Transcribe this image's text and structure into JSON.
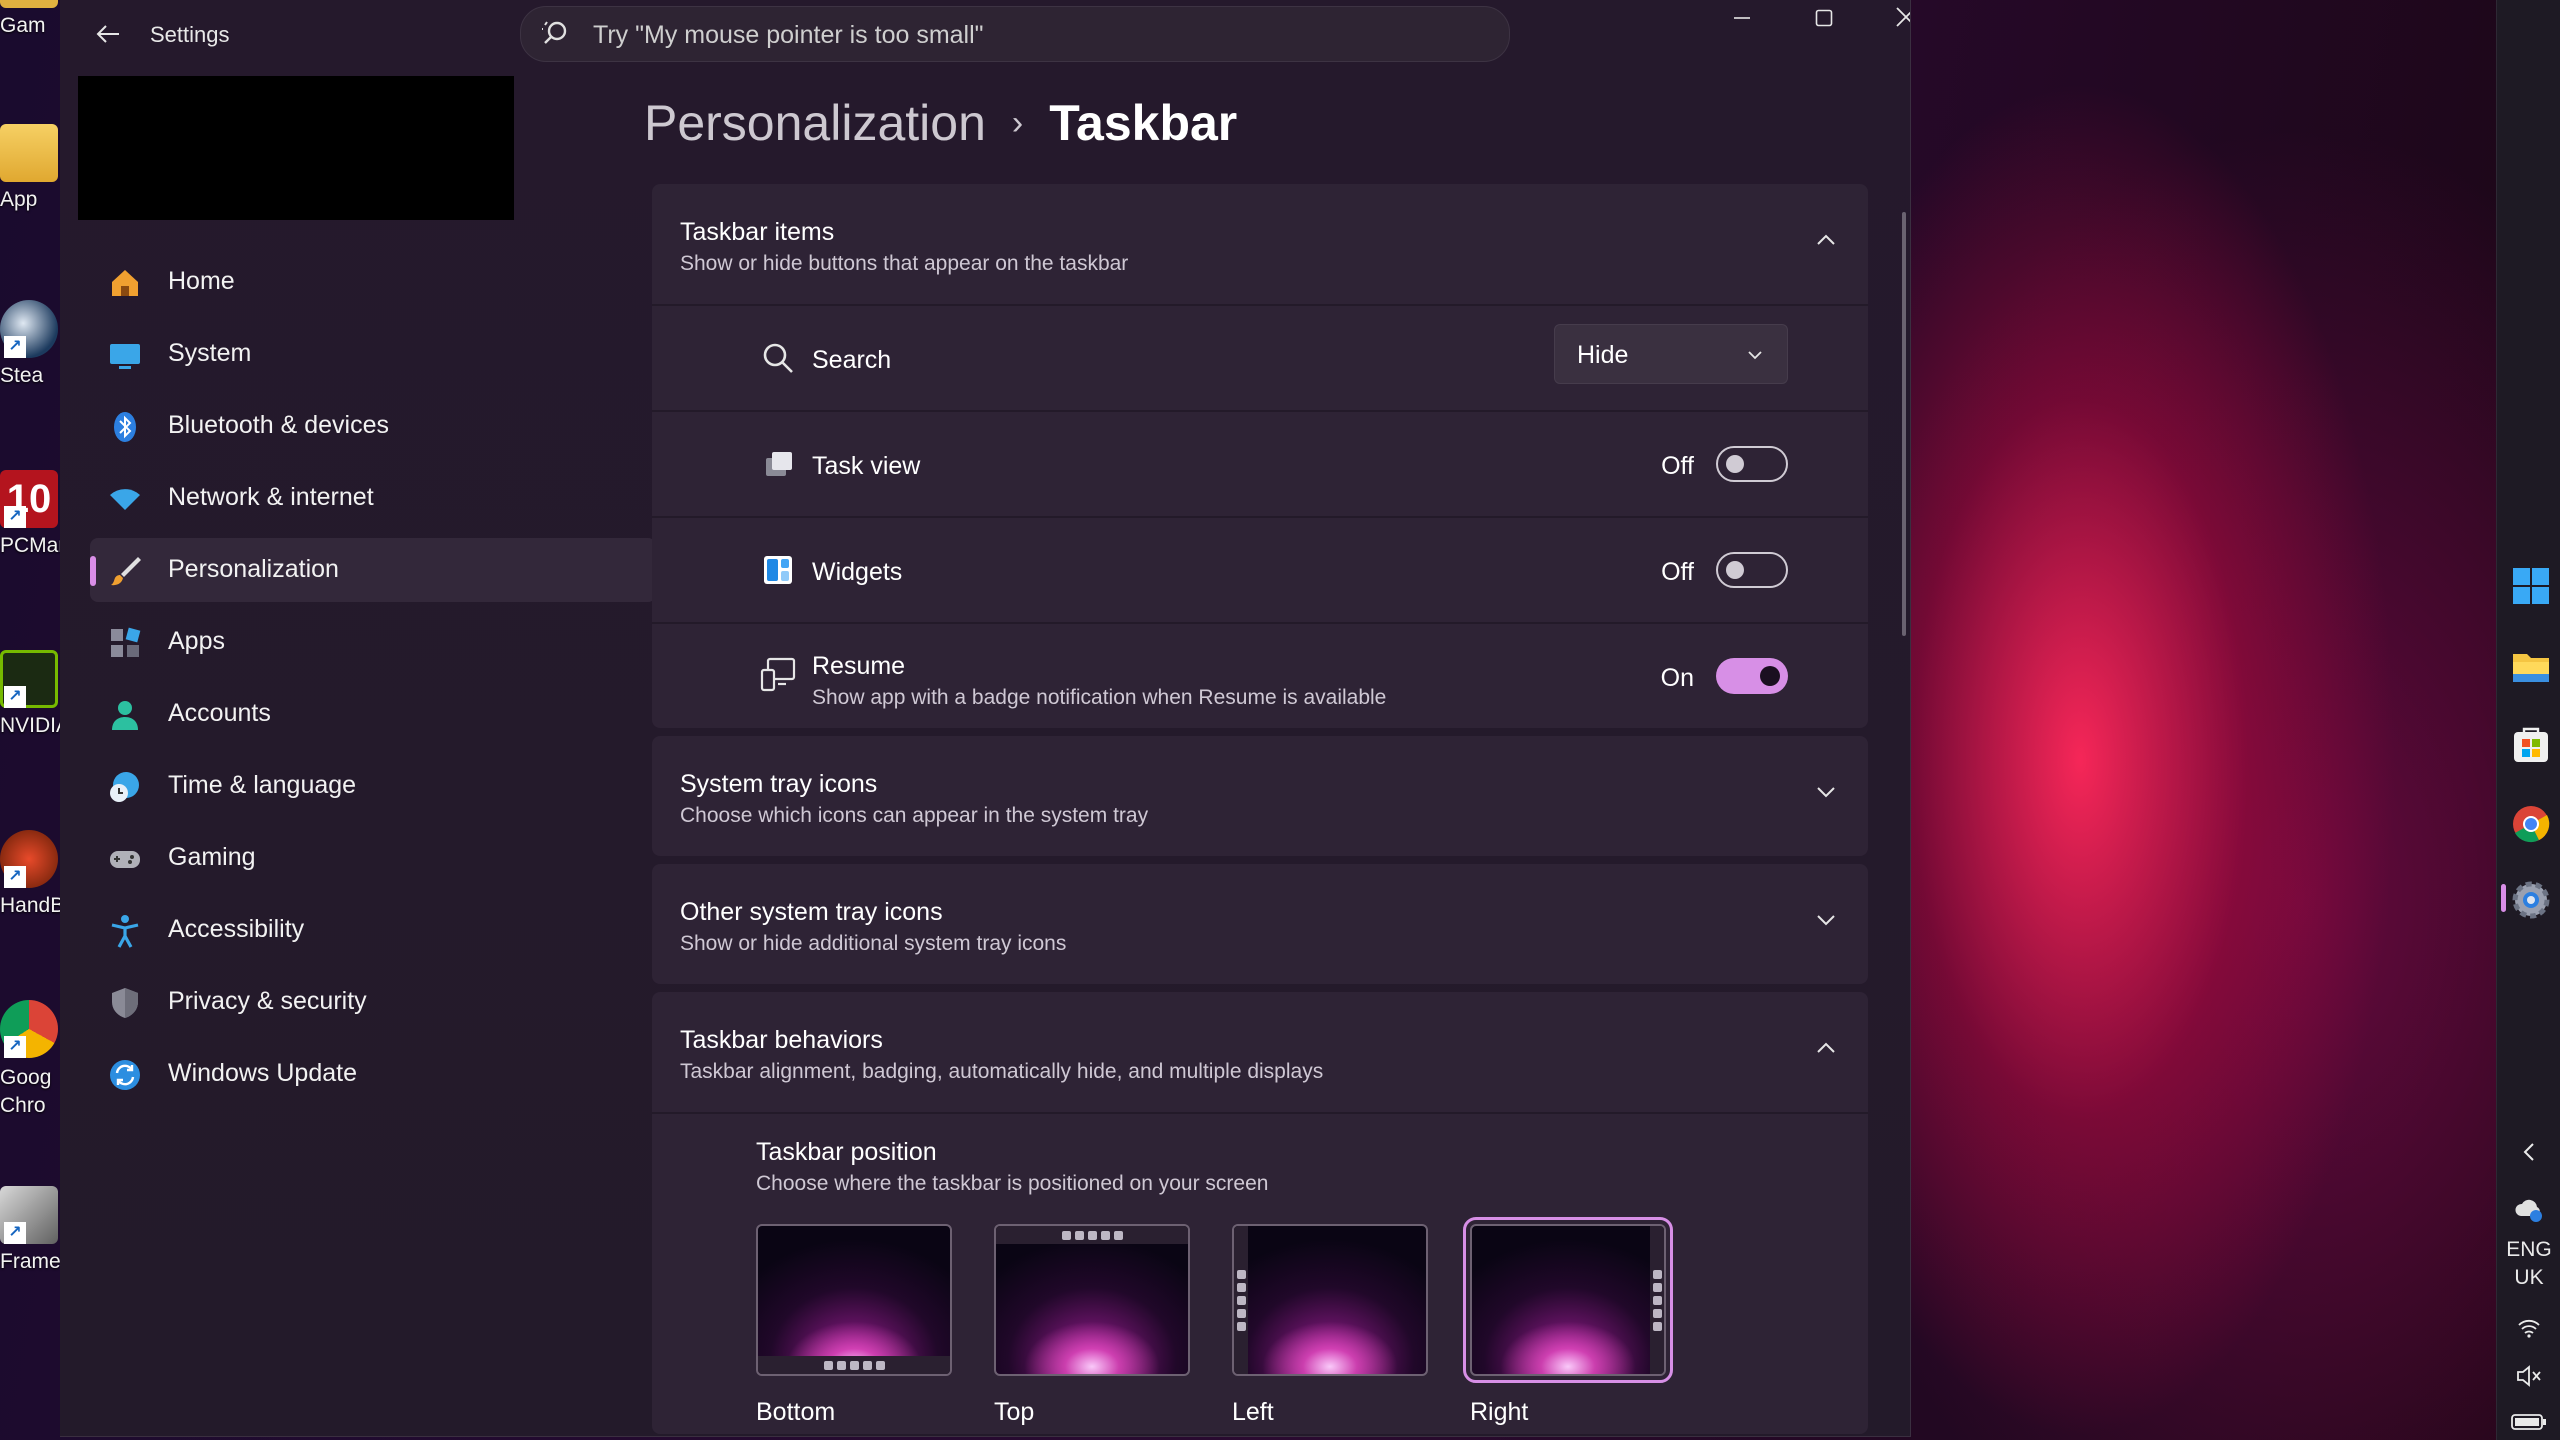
{
  "window": {
    "title": "Settings"
  },
  "search": {
    "placeholder": "Try \"My mouse pointer is too small\""
  },
  "desktop_icons": [
    "Gam",
    "App",
    "Stea",
    "PCMar",
    "NVIDIA",
    "HandB",
    "Goog Chro",
    "FrameV"
  ],
  "desktop_icon_badge": "10",
  "nav": [
    {
      "label": "Home",
      "icon": "home-icon"
    },
    {
      "label": "System",
      "icon": "system-icon"
    },
    {
      "label": "Bluetooth & devices",
      "icon": "bluetooth-icon"
    },
    {
      "label": "Network & internet",
      "icon": "wifi-icon"
    },
    {
      "label": "Personalization",
      "icon": "brush-icon",
      "active": true
    },
    {
      "label": "Apps",
      "icon": "apps-icon"
    },
    {
      "label": "Accounts",
      "icon": "accounts-icon"
    },
    {
      "label": "Time & language",
      "icon": "clock-globe-icon"
    },
    {
      "label": "Gaming",
      "icon": "gamepad-icon"
    },
    {
      "label": "Accessibility",
      "icon": "accessibility-icon"
    },
    {
      "label": "Privacy & security",
      "icon": "shield-icon"
    },
    {
      "label": "Windows Update",
      "icon": "update-icon"
    }
  ],
  "breadcrumb": {
    "parent": "Personalization",
    "separator": "›",
    "current": "Taskbar"
  },
  "sections": {
    "taskbar_items": {
      "title": "Taskbar items",
      "desc": "Show or hide buttons that appear on the taskbar",
      "expanded": true,
      "rows": {
        "search": {
          "label": "Search",
          "value": "Hide"
        },
        "task_view": {
          "label": "Task view",
          "state": "Off"
        },
        "widgets": {
          "label": "Widgets",
          "state": "Off"
        },
        "resume": {
          "label": "Resume",
          "desc": "Show app with a badge notification when Resume is available",
          "state": "On"
        }
      }
    },
    "system_tray": {
      "title": "System tray icons",
      "desc": "Choose which icons can appear in the system tray",
      "expanded": false
    },
    "other_tray": {
      "title": "Other system tray icons",
      "desc": "Show or hide additional system tray icons",
      "expanded": false
    },
    "behaviors": {
      "title": "Taskbar behaviors",
      "desc": "Taskbar alignment, badging, automatically hide, and multiple displays",
      "expanded": true,
      "position": {
        "title": "Taskbar position",
        "desc": "Choose where the taskbar is positioned on your screen",
        "options": [
          "Bottom",
          "Top",
          "Left",
          "Right"
        ],
        "selected": "Right"
      }
    }
  },
  "tray": {
    "lang1": "ENG",
    "lang2": "UK"
  },
  "colors": {
    "accent": "#d78fe6",
    "window_bg": "#25192c",
    "card_bg": "#2e2335"
  }
}
